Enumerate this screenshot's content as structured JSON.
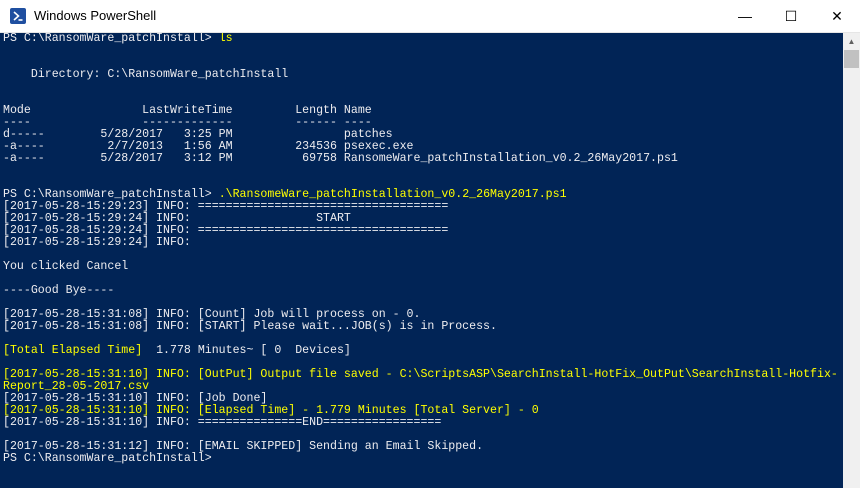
{
  "window": {
    "title": "Windows PowerShell",
    "minimize_glyph": "—",
    "maximize_glyph": "☐",
    "close_glyph": "✕",
    "icon": "powershell-icon"
  },
  "console": {
    "lines": [
      {
        "text": "PS C:\\RansomWare_patchInstall> ",
        "hl": "ls"
      },
      {
        "text": ""
      },
      {
        "text": ""
      },
      {
        "text": "    Directory: C:\\RansomWare_patchInstall"
      },
      {
        "text": ""
      },
      {
        "text": ""
      },
      {
        "text": "Mode                LastWriteTime         Length Name"
      },
      {
        "text": "----                -------------         ------ ----"
      },
      {
        "text": "d-----        5/28/2017   3:25 PM                patches"
      },
      {
        "text": "-a----         2/7/2013   1:56 AM         234536 psexec.exe"
      },
      {
        "text": "-a----        5/28/2017   3:12 PM          69758 RansomeWare_patchInstallation_v0.2_26May2017.ps1"
      },
      {
        "text": ""
      },
      {
        "text": ""
      },
      {
        "text": "PS C:\\RansomWare_patchInstall> ",
        "hl": ".\\RansomeWare_patchInstallation_v0.2_26May2017.ps1"
      },
      {
        "text": "[2017-05-28-15:29:23] INFO: ===================================="
      },
      {
        "text": "[2017-05-28-15:29:24] INFO:                  START"
      },
      {
        "text": "[2017-05-28-15:29:24] INFO: ===================================="
      },
      {
        "text": "[2017-05-28-15:29:24] INFO:"
      },
      {
        "text": ""
      },
      {
        "text": "You clicked Cancel"
      },
      {
        "text": ""
      },
      {
        "text": "----Good Bye----"
      },
      {
        "text": ""
      },
      {
        "text": "[2017-05-28-15:31:08] INFO: [Count] Job will process on - 0."
      },
      {
        "text": "[2017-05-28-15:31:08] INFO: [START] Please wait...JOB(s) is in Process."
      },
      {
        "text": ""
      },
      {
        "text": "",
        "hl": "[Total Elapsed Time]",
        "rest": "  1.778 Minutes~ [ 0  Devices]"
      },
      {
        "text": ""
      },
      {
        "text": "",
        "hl": "[2017-05-28-15:31:10] INFO: [OutPut] Output file saved - C:\\ScriptsASP\\SearchInstall-HotFix_OutPut\\SearchInstall-Hotfix-"
      },
      {
        "text": "",
        "hl": "Report_28-05-2017.csv"
      },
      {
        "text": "[2017-05-28-15:31:10] INFO: [Job Done]"
      },
      {
        "text": "",
        "hl": "[2017-05-28-15:31:10] INFO: [Elapsed Time] - 1.779 Minutes [Total Server] - 0"
      },
      {
        "text": "[2017-05-28-15:31:10] INFO: ===============END================="
      },
      {
        "text": ""
      },
      {
        "text": "[2017-05-28-15:31:12] INFO: [EMAIL SKIPPED] Sending an Email Skipped."
      },
      {
        "text": "PS C:\\RansomWare_patchInstall>"
      }
    ]
  },
  "scrollbar": {
    "up_glyph": "▲"
  },
  "colors": {
    "console_bg": "#012456",
    "console_fg": "#eeedf0",
    "highlight": "#ffff00"
  }
}
